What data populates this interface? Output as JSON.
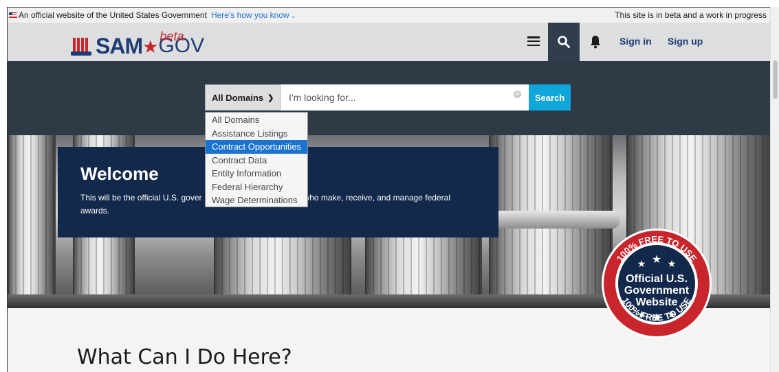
{
  "gov_banner": {
    "official_text": "An official website of the United States Government",
    "how_link": "Here's how you know",
    "beta_note": "This site is in beta and a work in progress"
  },
  "header": {
    "logo_sam": "SAM",
    "logo_gov": "GOV",
    "logo_beta": "beta",
    "sign_in": "Sign in",
    "sign_up": "Sign up"
  },
  "search": {
    "domain_selected": "All Domains",
    "placeholder": "I'm looking for...",
    "button_label": "Search",
    "options": [
      "All Domains",
      "Assistance Listings",
      "Contract Opportunities",
      "Contract Data",
      "Entity Information",
      "Federal Hierarchy",
      "Wage Determinations"
    ],
    "highlighted_index": 2
  },
  "welcome": {
    "title": "Welcome",
    "text_left": "This will be the official U.S. gover",
    "text_right": "who make, receive, and manage federal",
    "text_line2": "awards."
  },
  "seal": {
    "ring_text": "100% FREE TO USE",
    "line1": "Official U.S.",
    "line2": "Government",
    "line3": "Website"
  },
  "section": {
    "title": "What Can I Do Here?"
  },
  "colors": {
    "navy": "#13294b",
    "accent_blue": "#10a6d9",
    "red": "#c9252c",
    "highlight": "#1b73d1"
  }
}
